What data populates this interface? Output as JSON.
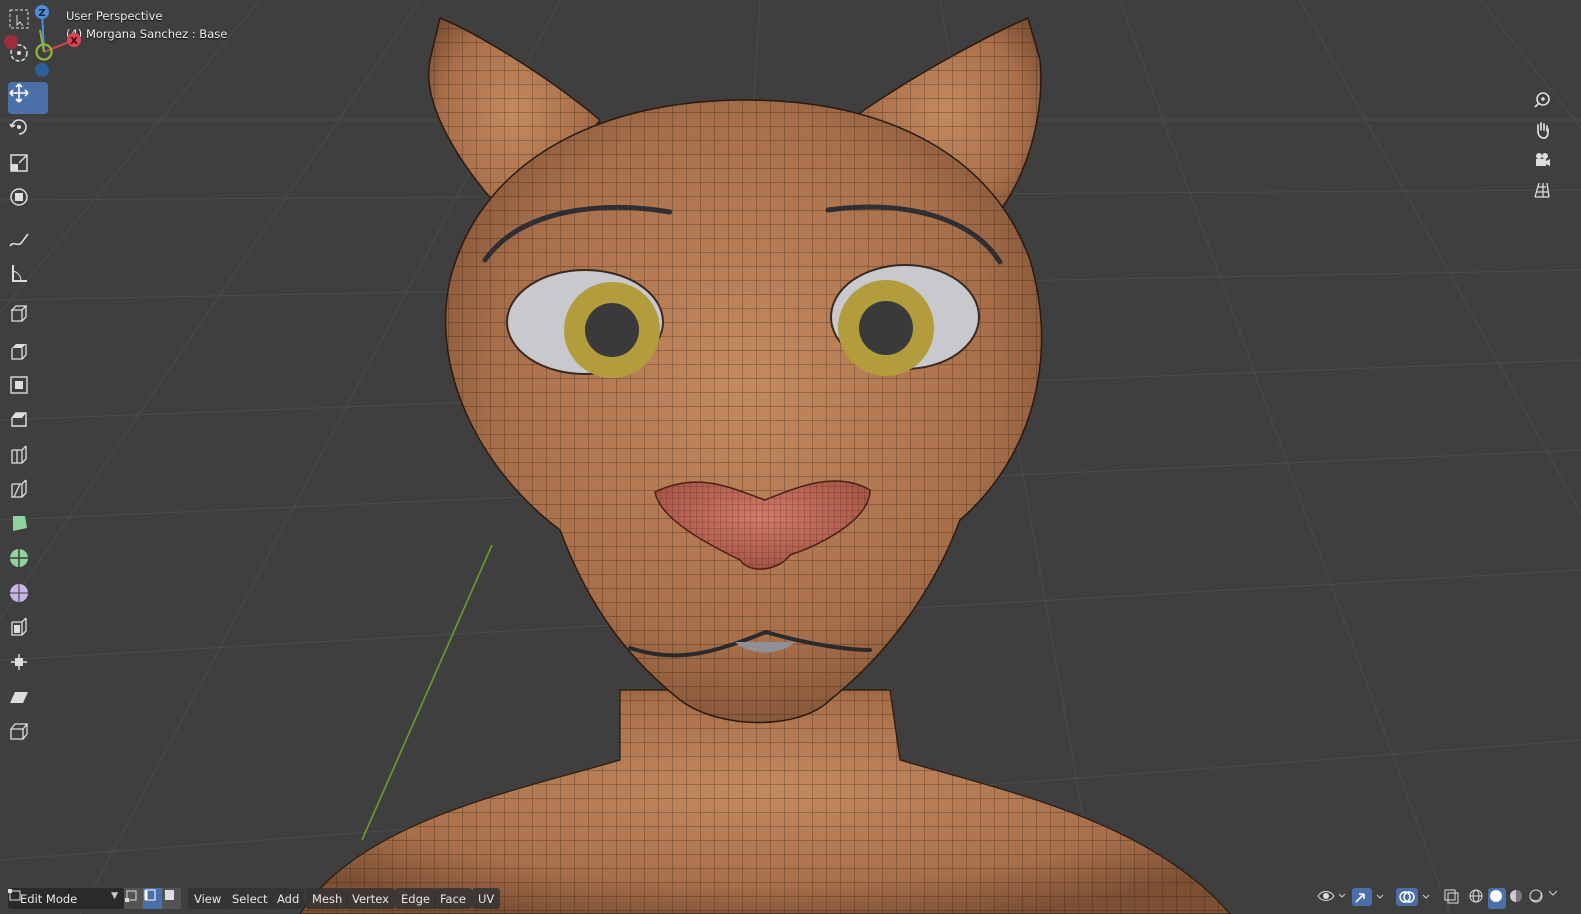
{
  "viewport": {
    "title": "User Perspective",
    "object_info": "(4) Morgana Sanchez : Base",
    "colors": {
      "background": "#3f3f3f",
      "grid": "#4c4c4c",
      "y_axis": "#6d9b2d",
      "skin": "#b57a52",
      "nose": "#c06a58",
      "iris": "#b39c3c",
      "sclera": "#c7c9cc"
    }
  },
  "toolbar": {
    "tools": [
      {
        "name": "select-box-tool",
        "icon": "select-box-icon"
      },
      {
        "name": "cursor-tool",
        "icon": "cursor-icon"
      },
      {
        "name": "move-tool",
        "icon": "move-icon",
        "active": true
      },
      {
        "name": "rotate-tool",
        "icon": "rotate-icon"
      },
      {
        "name": "scale-tool",
        "icon": "scale-icon"
      },
      {
        "name": "transform-tool",
        "icon": "transform-icon"
      },
      {
        "name": "annotate-tool",
        "icon": "annotate-icon"
      },
      {
        "name": "measure-tool",
        "icon": "measure-icon"
      },
      {
        "name": "add-cube-tool",
        "icon": "add-cube-icon"
      },
      {
        "name": "extrude-tool",
        "icon": "extrude-icon"
      },
      {
        "name": "inset-tool",
        "icon": "inset-icon"
      },
      {
        "name": "bevel-tool",
        "icon": "bevel-icon"
      },
      {
        "name": "loop-cut-tool",
        "icon": "loop-cut-icon"
      },
      {
        "name": "knife-tool",
        "icon": "knife-icon"
      },
      {
        "name": "poly-build-tool",
        "icon": "poly-build-icon"
      },
      {
        "name": "spin-tool",
        "icon": "spin-icon"
      },
      {
        "name": "smooth-tool",
        "icon": "smooth-icon"
      },
      {
        "name": "edge-slide-tool",
        "icon": "edge-slide-icon"
      },
      {
        "name": "shrink-fatten-tool",
        "icon": "shrink-fatten-icon"
      },
      {
        "name": "shear-tool",
        "icon": "shear-icon"
      },
      {
        "name": "rip-region-tool",
        "icon": "rip-region-icon"
      }
    ]
  },
  "gizmo": {
    "z": "Z",
    "x": "X"
  },
  "nav_buttons": [
    {
      "name": "zoom-button",
      "icon": "zoom-icon"
    },
    {
      "name": "pan-button",
      "icon": "hand-icon"
    },
    {
      "name": "camera-view-button",
      "icon": "camera-icon"
    },
    {
      "name": "ortho-toggle-button",
      "icon": "grid-icon"
    }
  ],
  "header": {
    "mode": "Edit Mode",
    "menus": [
      "View",
      "Select",
      "Add",
      "Mesh",
      "Vertex",
      "Edge",
      "Face",
      "UV"
    ],
    "select_modes": [
      "vertex-select-icon",
      "edge-select-icon",
      "face-select-icon"
    ],
    "active_select_mode": "edge-select-icon",
    "right_icons": [
      "visibility-icon",
      "gizmo-icon",
      "overlay-icon",
      "xray-icon",
      "wireframe-shading-icon",
      "solid-shading-icon",
      "material-shading-icon",
      "rendered-shading-icon"
    ]
  }
}
